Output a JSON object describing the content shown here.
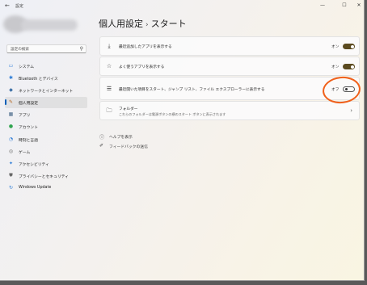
{
  "window": {
    "title": "設定",
    "controls": {
      "minimize": "—",
      "maximize": "☐",
      "close": "✕"
    }
  },
  "search": {
    "placeholder": "設定の検索"
  },
  "sidebar": {
    "items": [
      {
        "label": "システム",
        "icon": "monitor-icon",
        "glyph": "▭",
        "color": "#2a7ad6"
      },
      {
        "label": "Bluetooth とデバイス",
        "icon": "bluetooth-icon",
        "glyph": "✱",
        "color": "#2a7ad6"
      },
      {
        "label": "ネットワークとインターネット",
        "icon": "network-icon",
        "glyph": "◆",
        "color": "#3a6ea5"
      },
      {
        "label": "個人用設定",
        "icon": "brush-icon",
        "glyph": "✎",
        "color": "#b5651d",
        "active": true
      },
      {
        "label": "アプリ",
        "icon": "apps-icon",
        "glyph": "▦",
        "color": "#4a6a8a"
      },
      {
        "label": "アカウント",
        "icon": "person-icon",
        "glyph": "●",
        "color": "#2fa44f"
      },
      {
        "label": "時刻と言語",
        "icon": "clock-globe-icon",
        "glyph": "◔",
        "color": "#2a7ad6"
      },
      {
        "label": "ゲーム",
        "icon": "gamepad-icon",
        "glyph": "◎",
        "color": "#666666"
      },
      {
        "label": "アクセシビリティ",
        "icon": "accessibility-icon",
        "glyph": "✦",
        "color": "#2a7ad6"
      },
      {
        "label": "プライバシーとセキュリティ",
        "icon": "shield-icon",
        "glyph": "⛊",
        "color": "#666666"
      },
      {
        "label": "Windows Update",
        "icon": "update-icon",
        "glyph": "↻",
        "color": "#2a7ad6"
      }
    ]
  },
  "breadcrumb": {
    "parent": "個人用設定",
    "separator": "›",
    "current": "スタート"
  },
  "settings": [
    {
      "label": "最近追加したアプリを表示する",
      "icon": "download-icon",
      "glyph": "⤓",
      "state": "オン",
      "on": true
    },
    {
      "label": "よく使うアプリを表示する",
      "icon": "star-icon",
      "glyph": "☆",
      "state": "オン",
      "on": true
    },
    {
      "label": "最近開いた項目をスタート、ジャンプ リスト、ファイル エクスプローラーに表示する",
      "icon": "list-icon",
      "glyph": "☰",
      "state": "オフ",
      "on": false
    }
  ],
  "folders": {
    "label": "フォルダー",
    "sub": "これらのフォルダーは電源ボタンの横のスタート ボタンに表示されます",
    "icon": "folder-icon",
    "glyph": "▭"
  },
  "help": {
    "get_help": "ヘルプを表示",
    "feedback": "フィードバックの送信"
  },
  "colors": {
    "accent": "#5b4a1f",
    "annotation": "#f0601a"
  }
}
